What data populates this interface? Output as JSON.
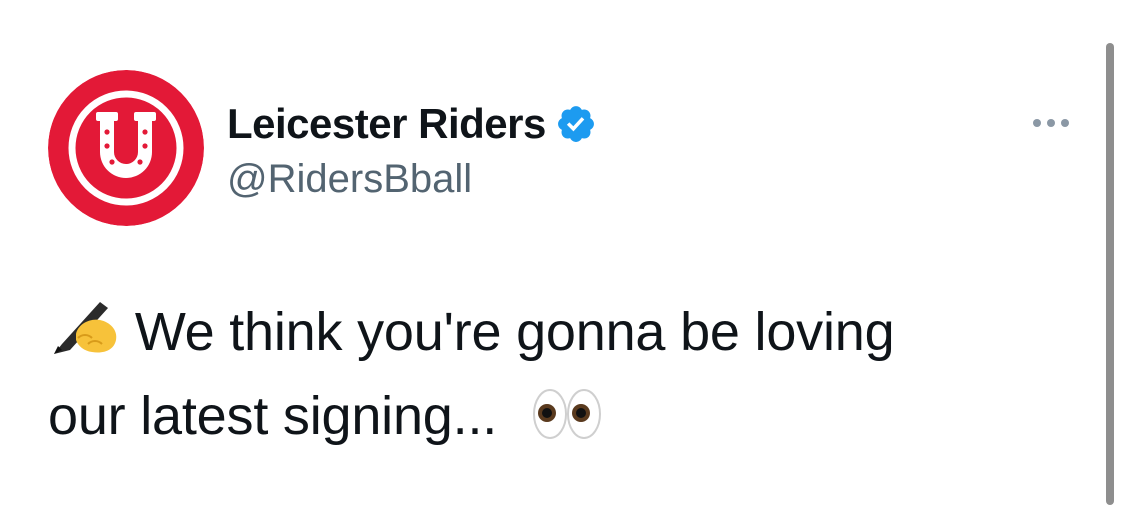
{
  "tweet": {
    "author": {
      "display_name": "Leicester Riders",
      "handle": "@RidersBball",
      "verified": true,
      "avatar_icon": "horseshoe-logo-icon",
      "avatar_color": "#e31937"
    },
    "more_icon": "more-options-icon",
    "text_line_1": "We think you're gonna be loving",
    "text_line_2": "our latest signing...",
    "emoji_start": "writing-hand-emoji",
    "emoji_end": "eyes-emoji"
  },
  "colors": {
    "verified_badge": "#1d9bf0",
    "handle": "#536471",
    "text": "#0f1419"
  }
}
